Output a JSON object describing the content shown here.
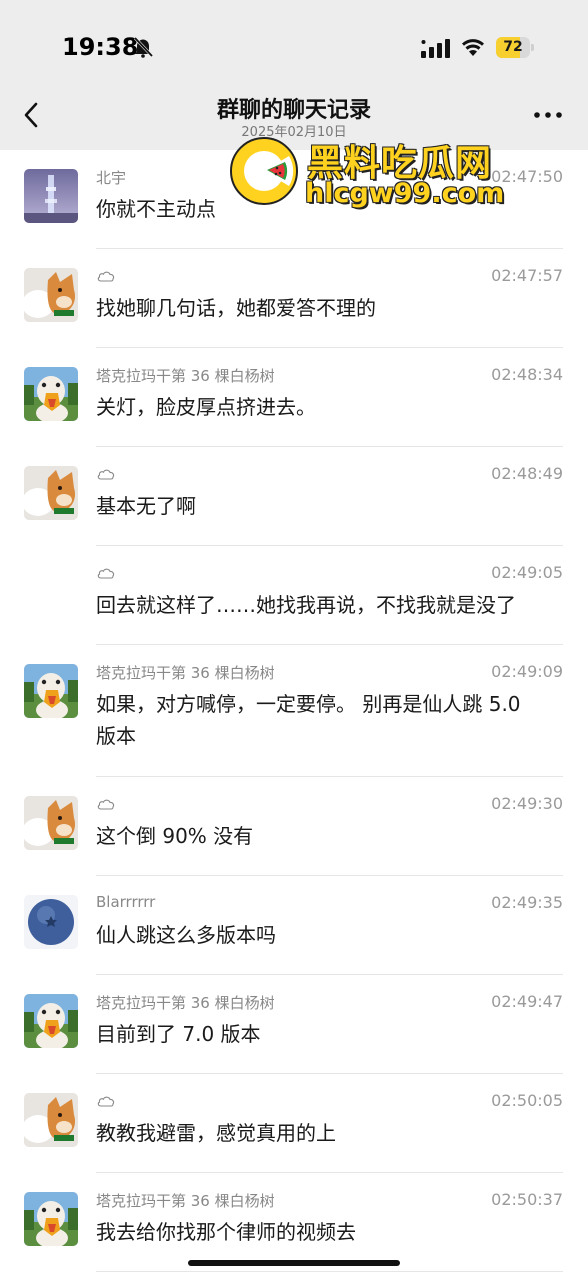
{
  "status_bar": {
    "time": "19:38",
    "battery": "72",
    "battery_level": 0.72
  },
  "header": {
    "title": "群聊的聊天记录",
    "subtitle": "2025年02月10日"
  },
  "watermark": {
    "line1": "黑料吃瓜网",
    "line2": "hlcgw99.com"
  },
  "icons": {
    "back": "chevron-left-icon",
    "more": "more-dots-icon",
    "bell_muted": "bell-slash-icon",
    "signal": "signal-icon",
    "wifi": "wifi-icon",
    "cloud": "cloud-icon"
  },
  "colors": {
    "header_bg": "#ededed",
    "battery_fill": "#f7cf2f",
    "watermark": "#ffd21f"
  },
  "messages": [
    {
      "avatar": "city-tower",
      "name": "北宇",
      "time": "02:47:50",
      "text": [
        "你就不主动点"
      ]
    },
    {
      "avatar": "shiba-dog",
      "name": "",
      "time": "02:47:57",
      "text": [
        "找她聊几句话，她都爱答不理的"
      ]
    },
    {
      "avatar": "duck",
      "name": "塔克拉玛干第 36 棵白杨树",
      "time": "02:48:34",
      "text": [
        "关灯，脸皮厚点挤进去。"
      ]
    },
    {
      "avatar": "shiba-dog",
      "name": "",
      "time": "02:48:49",
      "text": [
        "基本无了啊"
      ]
    },
    {
      "avatar": "none",
      "name": "",
      "time": "02:49:05",
      "text": [
        "回去就这样了……她找我再说，不找我就是没了"
      ]
    },
    {
      "avatar": "duck",
      "name": "塔克拉玛干第 36 棵白杨树",
      "time": "02:49:09",
      "text": [
        "如果，对方喊停，一定要停。 别再是仙人跳 5.0",
        "版本"
      ]
    },
    {
      "avatar": "shiba-dog",
      "name": "",
      "time": "02:49:30",
      "text": [
        "这个倒 90% 没有"
      ]
    },
    {
      "avatar": "blueberry",
      "name": "Blarrrrrr",
      "time": "02:49:35",
      "text": [
        "仙人跳这么多版本吗"
      ]
    },
    {
      "avatar": "duck",
      "name": "塔克拉玛干第 36 棵白杨树",
      "time": "02:49:47",
      "text": [
        "目前到了 7.0 版本"
      ]
    },
    {
      "avatar": "shiba-dog",
      "name": "",
      "time": "02:50:05",
      "text": [
        "教教我避雷，感觉真用的上"
      ]
    },
    {
      "avatar": "duck",
      "name": "塔克拉玛干第 36 棵白杨树",
      "time": "02:50:37",
      "text": [
        "我去给你找那个律师的视频去"
      ]
    }
  ]
}
